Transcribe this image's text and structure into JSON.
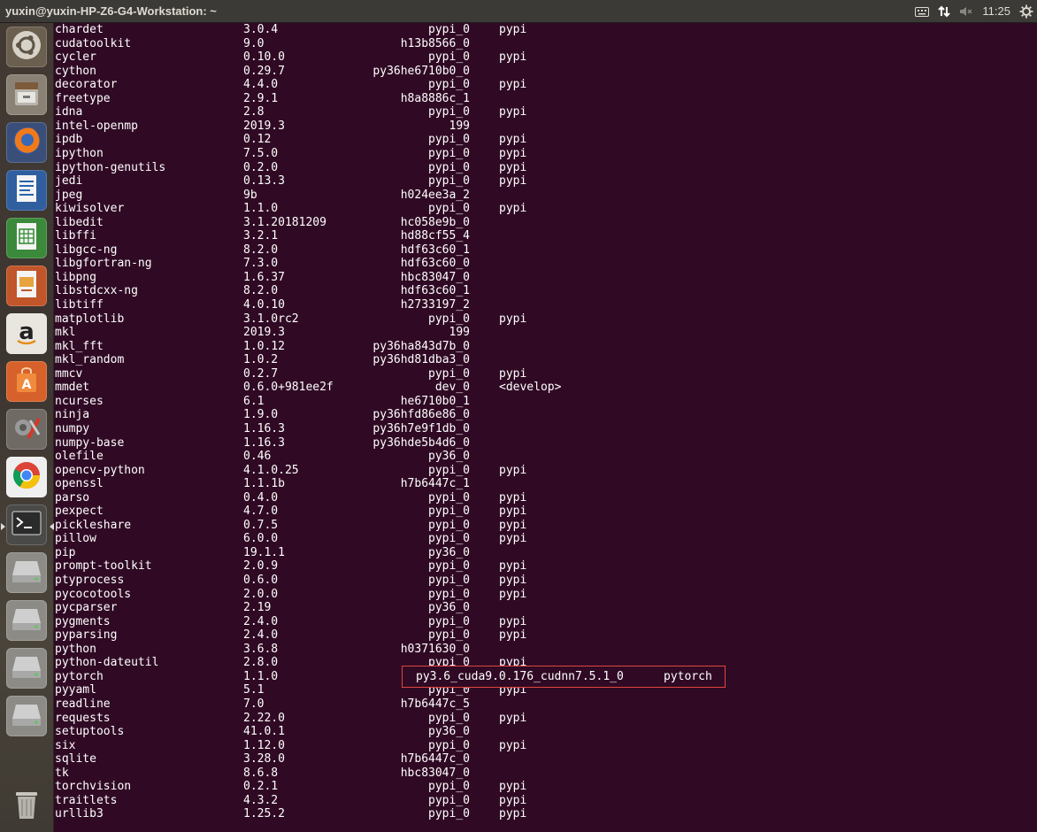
{
  "window": {
    "title": "yuxin@yuxin-HP-Z6-G4-Workstation: ~",
    "indicators": {
      "keyboard_icon": "keyboard-icon",
      "network_icon": "network-updown-icon",
      "volume_icon": "volume-muted-icon",
      "time": "11:25",
      "settings_icon": "gear-power-icon"
    }
  },
  "launcher": {
    "items": [
      {
        "name": "ubuntu-dash",
        "icon": "ubuntu-logo-icon"
      },
      {
        "name": "files",
        "icon": "file-cabinet-icon"
      },
      {
        "name": "firefox",
        "icon": "firefox-icon"
      },
      {
        "name": "libreoffice-writer",
        "icon": "writer-document-icon"
      },
      {
        "name": "libreoffice-calc",
        "icon": "calc-spreadsheet-icon"
      },
      {
        "name": "libreoffice-impress",
        "icon": "impress-presentation-icon"
      },
      {
        "name": "amazon",
        "icon": "amazon-a-icon"
      },
      {
        "name": "software-center",
        "icon": "shopping-bag-icon"
      },
      {
        "name": "system-settings",
        "icon": "tools-gear-icon"
      },
      {
        "name": "chrome",
        "icon": "chrome-icon"
      },
      {
        "name": "terminal",
        "icon": "terminal-prompt-icon"
      },
      {
        "name": "drive-1",
        "icon": "hard-drive-icon"
      },
      {
        "name": "drive-2",
        "icon": "hard-drive-icon"
      },
      {
        "name": "drive-3",
        "icon": "hard-drive-icon"
      },
      {
        "name": "drive-4",
        "icon": "hard-drive-icon"
      },
      {
        "name": "trash",
        "icon": "trash-icon"
      }
    ]
  },
  "packages": [
    [
      "chardet",
      "3.0.4",
      "pypi_0",
      "pypi"
    ],
    [
      "cudatoolkit",
      "9.0",
      "h13b8566_0",
      ""
    ],
    [
      "cycler",
      "0.10.0",
      "pypi_0",
      "pypi"
    ],
    [
      "cython",
      "0.29.7",
      "py36he6710b0_0",
      ""
    ],
    [
      "decorator",
      "4.4.0",
      "pypi_0",
      "pypi"
    ],
    [
      "freetype",
      "2.9.1",
      "h8a8886c_1",
      ""
    ],
    [
      "idna",
      "2.8",
      "pypi_0",
      "pypi"
    ],
    [
      "intel-openmp",
      "2019.3",
      "199",
      ""
    ],
    [
      "ipdb",
      "0.12",
      "pypi_0",
      "pypi"
    ],
    [
      "ipython",
      "7.5.0",
      "pypi_0",
      "pypi"
    ],
    [
      "ipython-genutils",
      "0.2.0",
      "pypi_0",
      "pypi"
    ],
    [
      "jedi",
      "0.13.3",
      "pypi_0",
      "pypi"
    ],
    [
      "jpeg",
      "9b",
      "h024ee3a_2",
      ""
    ],
    [
      "kiwisolver",
      "1.1.0",
      "pypi_0",
      "pypi"
    ],
    [
      "libedit",
      "3.1.20181209",
      "hc058e9b_0",
      ""
    ],
    [
      "libffi",
      "3.2.1",
      "hd88cf55_4",
      ""
    ],
    [
      "libgcc-ng",
      "8.2.0",
      "hdf63c60_1",
      ""
    ],
    [
      "libgfortran-ng",
      "7.3.0",
      "hdf63c60_0",
      ""
    ],
    [
      "libpng",
      "1.6.37",
      "hbc83047_0",
      ""
    ],
    [
      "libstdcxx-ng",
      "8.2.0",
      "hdf63c60_1",
      ""
    ],
    [
      "libtiff",
      "4.0.10",
      "h2733197_2",
      ""
    ],
    [
      "matplotlib",
      "3.1.0rc2",
      "pypi_0",
      "pypi"
    ],
    [
      "mkl",
      "2019.3",
      "199",
      ""
    ],
    [
      "mkl_fft",
      "1.0.12",
      "py36ha843d7b_0",
      ""
    ],
    [
      "mkl_random",
      "1.0.2",
      "py36hd81dba3_0",
      ""
    ],
    [
      "mmcv",
      "0.2.7",
      "pypi_0",
      "pypi"
    ],
    [
      "mmdet",
      "0.6.0+981ee2f",
      "dev_0",
      "<develop>"
    ],
    [
      "ncurses",
      "6.1",
      "he6710b0_1",
      ""
    ],
    [
      "ninja",
      "1.9.0",
      "py36hfd86e86_0",
      ""
    ],
    [
      "numpy",
      "1.16.3",
      "py36h7e9f1db_0",
      ""
    ],
    [
      "numpy-base",
      "1.16.3",
      "py36hde5b4d6_0",
      ""
    ],
    [
      "olefile",
      "0.46",
      "py36_0",
      ""
    ],
    [
      "opencv-python",
      "4.1.0.25",
      "pypi_0",
      "pypi"
    ],
    [
      "openssl",
      "1.1.1b",
      "h7b6447c_1",
      ""
    ],
    [
      "parso",
      "0.4.0",
      "pypi_0",
      "pypi"
    ],
    [
      "pexpect",
      "4.7.0",
      "pypi_0",
      "pypi"
    ],
    [
      "pickleshare",
      "0.7.5",
      "pypi_0",
      "pypi"
    ],
    [
      "pillow",
      "6.0.0",
      "pypi_0",
      "pypi"
    ],
    [
      "pip",
      "19.1.1",
      "py36_0",
      ""
    ],
    [
      "prompt-toolkit",
      "2.0.9",
      "pypi_0",
      "pypi"
    ],
    [
      "ptyprocess",
      "0.6.0",
      "pypi_0",
      "pypi"
    ],
    [
      "pycocotools",
      "2.0.0",
      "pypi_0",
      "pypi"
    ],
    [
      "pycparser",
      "2.19",
      "py36_0",
      ""
    ],
    [
      "pygments",
      "2.4.0",
      "pypi_0",
      "pypi"
    ],
    [
      "pyparsing",
      "2.4.0",
      "pypi_0",
      "pypi"
    ],
    [
      "python",
      "3.6.8",
      "h0371630_0",
      ""
    ],
    [
      "python-dateutil",
      "2.8.0",
      "pypi_0",
      "pypi"
    ],
    [
      "pytorch",
      "1.1.0",
      "",
      ""
    ],
    [
      "pyyaml",
      "5.1",
      "pypi_0",
      "pypi"
    ],
    [
      "readline",
      "7.0",
      "h7b6447c_5",
      ""
    ],
    [
      "requests",
      "2.22.0",
      "pypi_0",
      "pypi"
    ],
    [
      "setuptools",
      "41.0.1",
      "py36_0",
      ""
    ],
    [
      "six",
      "1.12.0",
      "pypi_0",
      "pypi"
    ],
    [
      "sqlite",
      "3.28.0",
      "h7b6447c_0",
      ""
    ],
    [
      "tk",
      "8.6.8",
      "hbc83047_0",
      ""
    ],
    [
      "torchvision",
      "0.2.1",
      "pypi_0",
      "pypi"
    ],
    [
      "traitlets",
      "4.3.2",
      "pypi_0",
      "pypi"
    ],
    [
      "urllib3",
      "1.25.2",
      "pypi_0",
      "pypi"
    ]
  ],
  "highlight": {
    "build": "py3.6_cuda9.0.176_cudnn7.5.1_0",
    "channel": "pytorch",
    "border_color": "#e0453f"
  },
  "colors": {
    "terminal_bg": "#300a24",
    "terminal_fg": "#ffffff",
    "topbar_bg": "#3b3a36"
  }
}
